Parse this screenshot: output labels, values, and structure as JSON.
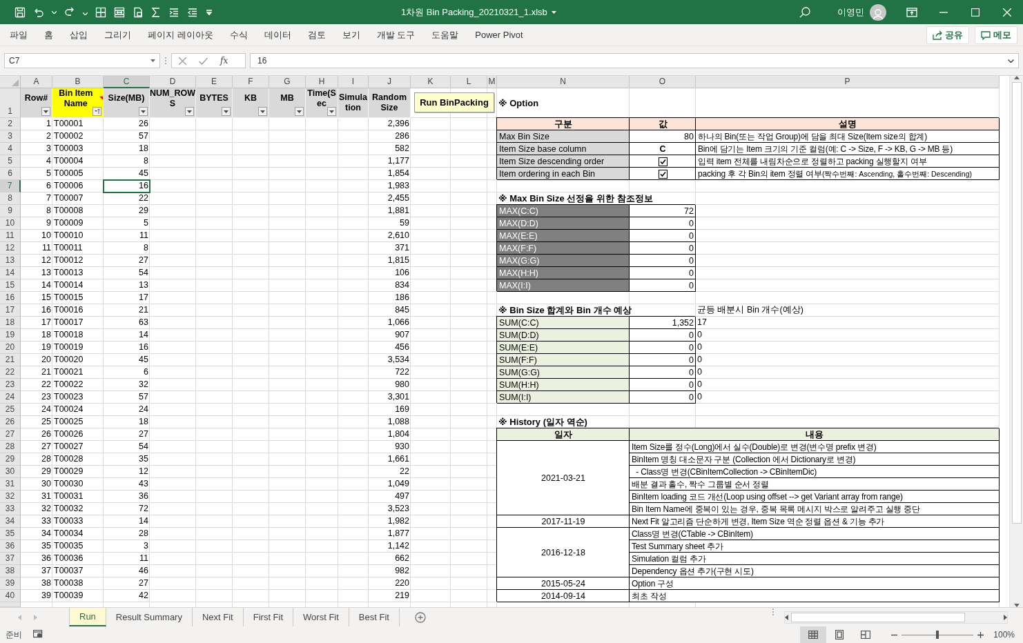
{
  "window": {
    "title": "1차원 Bin Packing_20210321_1.xlsb",
    "user": "이영민"
  },
  "ribbon_tabs": [
    "파일",
    "홈",
    "삽입",
    "그리기",
    "페이지 레이아웃",
    "수식",
    "데이터",
    "검토",
    "보기",
    "개발 도구",
    "도움말",
    "Power Pivot"
  ],
  "ribbon_buttons": [
    "공유",
    "메모"
  ],
  "name_box": "C7",
  "fx": "fx",
  "formula": "16",
  "columns": [
    {
      "label": "A",
      "selected": false
    },
    {
      "label": "B",
      "selected": false
    },
    {
      "label": "C",
      "selected": true
    },
    {
      "label": "D",
      "selected": false
    },
    {
      "label": "E",
      "selected": false
    },
    {
      "label": "F",
      "selected": false
    },
    {
      "label": "G",
      "selected": false
    },
    {
      "label": "H",
      "selected": false
    },
    {
      "label": "I",
      "selected": false
    },
    {
      "label": "J",
      "selected": false
    },
    {
      "label": "K",
      "selected": false
    },
    {
      "label": "L",
      "selected": false
    },
    {
      "label": "M",
      "selected": false
    },
    {
      "label": "N",
      "selected": false
    },
    {
      "label": "O",
      "selected": false
    },
    {
      "label": "P",
      "selected": false
    }
  ],
  "rows": [
    {
      "label": "1",
      "selected": false
    },
    {
      "label": "2",
      "selected": false
    },
    {
      "label": "3",
      "selected": false
    },
    {
      "label": "4",
      "selected": false
    },
    {
      "label": "5",
      "selected": false
    },
    {
      "label": "6",
      "selected": false
    },
    {
      "label": "7",
      "selected": true
    },
    {
      "label": "8",
      "selected": false
    },
    {
      "label": "9",
      "selected": false
    },
    {
      "label": "10",
      "selected": false
    },
    {
      "label": "11",
      "selected": false
    },
    {
      "label": "12",
      "selected": false
    },
    {
      "label": "13",
      "selected": false
    },
    {
      "label": "14",
      "selected": false
    },
    {
      "label": "15",
      "selected": false
    },
    {
      "label": "16",
      "selected": false
    },
    {
      "label": "17",
      "selected": false
    },
    {
      "label": "18",
      "selected": false
    },
    {
      "label": "19",
      "selected": false
    },
    {
      "label": "20",
      "selected": false
    },
    {
      "label": "21",
      "selected": false
    },
    {
      "label": "22",
      "selected": false
    },
    {
      "label": "23",
      "selected": false
    },
    {
      "label": "24",
      "selected": false
    },
    {
      "label": "25",
      "selected": false
    },
    {
      "label": "26",
      "selected": false
    },
    {
      "label": "27",
      "selected": false
    },
    {
      "label": "28",
      "selected": false
    },
    {
      "label": "29",
      "selected": false
    },
    {
      "label": "30",
      "selected": false
    },
    {
      "label": "31",
      "selected": false
    },
    {
      "label": "32",
      "selected": false
    },
    {
      "label": "33",
      "selected": false
    },
    {
      "label": "34",
      "selected": false
    },
    {
      "label": "35",
      "selected": false
    },
    {
      "label": "36",
      "selected": false
    },
    {
      "label": "37",
      "selected": false
    },
    {
      "label": "38",
      "selected": false
    },
    {
      "label": "39",
      "selected": false
    },
    {
      "label": "40",
      "selected": false
    }
  ],
  "table_header": [
    {
      "label": "Row#",
      "filter": true,
      "sort": false,
      "highlight": false,
      "comment": false
    },
    {
      "label": "Bin Item Name",
      "filter": true,
      "sort": true,
      "highlight": true,
      "comment": true
    },
    {
      "label": "Size(MB)",
      "filter": true,
      "sort": false,
      "highlight": false,
      "comment": false
    },
    {
      "label": "NUM_ROWS",
      "filter": true,
      "sort": false,
      "highlight": false,
      "comment": false
    },
    {
      "label": "BYTES",
      "filter": true,
      "sort": false,
      "highlight": false,
      "comment": false
    },
    {
      "label": "KB",
      "filter": true,
      "sort": false,
      "highlight": false,
      "comment": false
    },
    {
      "label": "MB",
      "filter": true,
      "sort": false,
      "highlight": false,
      "comment": false
    },
    {
      "label": "Time(Sec",
      "filter": true,
      "sort": false,
      "highlight": false,
      "comment": false
    },
    {
      "label": "Simulation",
      "filter": false,
      "sort": false,
      "highlight": false,
      "comment": false
    },
    {
      "label": "Random Size",
      "filter": false,
      "sort": false,
      "highlight": false,
      "comment": false
    }
  ],
  "items": [
    {
      "row": "1",
      "name": "T00001",
      "size": "26",
      "random": "2,396",
      "selected": false
    },
    {
      "row": "2",
      "name": "T00002",
      "size": "57",
      "random": "286",
      "selected": false
    },
    {
      "row": "3",
      "name": "T00003",
      "size": "18",
      "random": "582",
      "selected": false
    },
    {
      "row": "4",
      "name": "T00004",
      "size": "8",
      "random": "1,177",
      "selected": false
    },
    {
      "row": "5",
      "name": "T00005",
      "size": "45",
      "random": "1,854",
      "selected": false
    },
    {
      "row": "6",
      "name": "T00006",
      "size": "16",
      "random": "1,983",
      "selected": true
    },
    {
      "row": "7",
      "name": "T00007",
      "size": "22",
      "random": "2,455",
      "selected": false
    },
    {
      "row": "8",
      "name": "T00008",
      "size": "29",
      "random": "1,881",
      "selected": false
    },
    {
      "row": "9",
      "name": "T00009",
      "size": "5",
      "random": "59",
      "selected": false
    },
    {
      "row": "10",
      "name": "T00010",
      "size": "11",
      "random": "2,610",
      "selected": false
    },
    {
      "row": "11",
      "name": "T00011",
      "size": "8",
      "random": "371",
      "selected": false
    },
    {
      "row": "12",
      "name": "T00012",
      "size": "27",
      "random": "1,815",
      "selected": false
    },
    {
      "row": "13",
      "name": "T00013",
      "size": "54",
      "random": "106",
      "selected": false
    },
    {
      "row": "14",
      "name": "T00014",
      "size": "13",
      "random": "834",
      "selected": false
    },
    {
      "row": "15",
      "name": "T00015",
      "size": "17",
      "random": "186",
      "selected": false
    },
    {
      "row": "16",
      "name": "T00016",
      "size": "21",
      "random": "845",
      "selected": false
    },
    {
      "row": "17",
      "name": "T00017",
      "size": "63",
      "random": "1,066",
      "selected": false
    },
    {
      "row": "18",
      "name": "T00018",
      "size": "14",
      "random": "907",
      "selected": false
    },
    {
      "row": "19",
      "name": "T00019",
      "size": "16",
      "random": "456",
      "selected": false
    },
    {
      "row": "20",
      "name": "T00020",
      "size": "45",
      "random": "3,534",
      "selected": false
    },
    {
      "row": "21",
      "name": "T00021",
      "size": "6",
      "random": "722",
      "selected": false
    },
    {
      "row": "22",
      "name": "T00022",
      "size": "32",
      "random": "980",
      "selected": false
    },
    {
      "row": "23",
      "name": "T00023",
      "size": "57",
      "random": "3,301",
      "selected": false
    },
    {
      "row": "24",
      "name": "T00024",
      "size": "24",
      "random": "169",
      "selected": false
    },
    {
      "row": "25",
      "name": "T00025",
      "size": "18",
      "random": "1,088",
      "selected": false
    },
    {
      "row": "26",
      "name": "T00026",
      "size": "27",
      "random": "1,804",
      "selected": false
    },
    {
      "row": "27",
      "name": "T00027",
      "size": "54",
      "random": "930",
      "selected": false
    },
    {
      "row": "28",
      "name": "T00028",
      "size": "35",
      "random": "1,661",
      "selected": false
    },
    {
      "row": "29",
      "name": "T00029",
      "size": "12",
      "random": "22",
      "selected": false
    },
    {
      "row": "30",
      "name": "T00030",
      "size": "43",
      "random": "1,049",
      "selected": false
    },
    {
      "row": "31",
      "name": "T00031",
      "size": "36",
      "random": "497",
      "selected": false
    },
    {
      "row": "32",
      "name": "T00032",
      "size": "72",
      "random": "3,523",
      "selected": false
    },
    {
      "row": "33",
      "name": "T00033",
      "size": "14",
      "random": "1,982",
      "selected": false
    },
    {
      "row": "34",
      "name": "T00034",
      "size": "28",
      "random": "1,877",
      "selected": false
    },
    {
      "row": "35",
      "name": "T00035",
      "size": "3",
      "random": "1,142",
      "selected": false
    },
    {
      "row": "36",
      "name": "T00036",
      "size": "11",
      "random": "662",
      "selected": false
    },
    {
      "row": "37",
      "name": "T00037",
      "size": "46",
      "random": "982",
      "selected": false
    },
    {
      "row": "38",
      "name": "T00038",
      "size": "27",
      "random": "220",
      "selected": false
    },
    {
      "row": "39",
      "name": "T00039",
      "size": "42",
      "random": "219",
      "selected": false
    }
  ],
  "run_button": "Run BinPacking",
  "option": {
    "title": "※ Option",
    "headers": [
      "구분",
      "값",
      "설명"
    ],
    "rows": [
      {
        "label": "Max Bin Size",
        "kind": "number",
        "value": "80",
        "desc": "하나의 Bin(또는 작업 Group)에 담을 최대 Size(Item size의 합계)"
      },
      {
        "label": "Item Size base column",
        "kind": "letter",
        "value": "C",
        "desc": "Bin에 담기는 Item 크기의 기준 컬럼(예: C -> Size, F -> KB, G -> MB 등)"
      },
      {
        "label": "Item Size descending order",
        "kind": "checkbox",
        "checked": true,
        "desc": "입력 item 전체를 내림차순으로 정렬하고 packing 실행할지 여부"
      },
      {
        "label": "Item ordering in each Bin",
        "kind": "checkbox",
        "checked": true,
        "desc": "packing 후 각 Bin의 item 정렬 여부",
        "note": "(짝수번째: Ascending, 홀수번째: Descending)"
      }
    ]
  },
  "reference": {
    "title": "※ Max Bin Size 선정을 위한 참조정보",
    "rows": [
      {
        "label": "MAX(C:C)",
        "value": "72"
      },
      {
        "label": "MAX(D:D)",
        "value": "0"
      },
      {
        "label": "MAX(E:E)",
        "value": "0"
      },
      {
        "label": "MAX(F:F)",
        "value": "0"
      },
      {
        "label": "MAX(G:G)",
        "value": "0"
      },
      {
        "label": "MAX(H:H)",
        "value": "0"
      },
      {
        "label": "MAX(I:I)",
        "value": "0"
      }
    ]
  },
  "estimate": {
    "title": "※ Bin Size 합계와 Bin 개수 예상",
    "note": "균등 배분시 Bin 개수(예상)",
    "rows": [
      {
        "label": "SUM(C:C)",
        "value": "1,352",
        "bins": "17"
      },
      {
        "label": "SUM(D:D)",
        "value": "0",
        "bins": "0"
      },
      {
        "label": "SUM(E:E)",
        "value": "0",
        "bins": "0"
      },
      {
        "label": "SUM(F:F)",
        "value": "0",
        "bins": "0"
      },
      {
        "label": "SUM(G:G)",
        "value": "0",
        "bins": "0"
      },
      {
        "label": "SUM(H:H)",
        "value": "0",
        "bins": "0"
      },
      {
        "label": "SUM(I:I)",
        "value": "0",
        "bins": "0"
      }
    ]
  },
  "history": {
    "title": "※ History (일자 역순)",
    "headers": [
      "일자",
      "내용"
    ],
    "groups": [
      {
        "date": "2021-03-21",
        "entries": [
          "Item Size를 정수(Long)에서 실수(Double)로 변경(변수명 prefix 변경)",
          "BinItem 명칭 대소문자 구분 (Collection 에서 Dictionary로 변경)",
          "  - Class명 변경(CBinItemCollection -> CBinItemDic)",
          "배분 결과 홀수, 짝수 그룹별 순서 정렬",
          "BinItem loading 코드 개선(Loop using offset --> get Variant array from range)",
          "Bin Item Name에 중복이 있는 경우, 중복 목록 메시지 박스로 알려주고 실행 중단"
        ]
      },
      {
        "date": "2017-11-19",
        "entries": [
          "Next Fit 알고리즘 단순하게 변경, Item Size 역순 정렬 옵션 & 기능 추가"
        ]
      },
      {
        "date": "2016-12-18",
        "entries": [
          "Class명 변경(CTable -> CBinItem)",
          "Test Summary sheet 추가",
          "Simulation 컬럼 추가",
          "Dependency 옵션 추가(구현 시도)"
        ]
      },
      {
        "date": "2015-05-24",
        "entries": [
          "Option 구성"
        ]
      },
      {
        "date": "2014-09-14",
        "entries": [
          "최초 작성"
        ]
      }
    ]
  },
  "sheet_tabs": [
    {
      "label": "Run",
      "selected": true
    },
    {
      "label": "Result Summary",
      "selected": false
    },
    {
      "label": "Next Fit",
      "selected": false
    },
    {
      "label": "First Fit",
      "selected": false
    },
    {
      "label": "Worst Fit",
      "selected": false
    },
    {
      "label": "Best Fit",
      "selected": false
    }
  ],
  "status": {
    "text": "준비",
    "zoom": "100%",
    "zoom_slider": {
      "level": 0.5
    }
  }
}
